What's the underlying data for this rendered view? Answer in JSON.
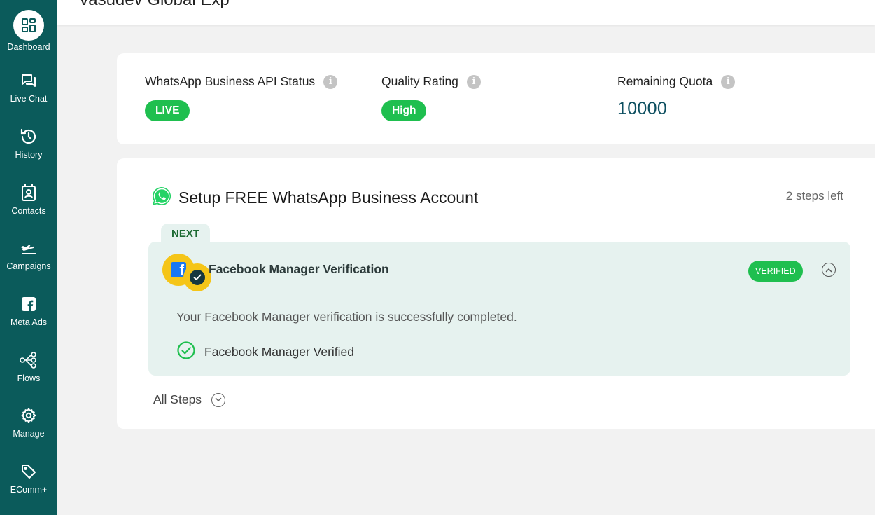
{
  "header": {
    "org_name": "Vasudev Global Exp"
  },
  "sidebar": {
    "items": [
      {
        "label": "Dashboard",
        "icon": "dashboard-icon"
      },
      {
        "label": "Live Chat",
        "icon": "chat-icon"
      },
      {
        "label": "History",
        "icon": "history-icon"
      },
      {
        "label": "Contacts",
        "icon": "contacts-icon"
      },
      {
        "label": "Campaigns",
        "icon": "plane-icon"
      },
      {
        "label": "Meta Ads",
        "icon": "facebook-icon"
      },
      {
        "label": "Flows",
        "icon": "flow-icon"
      },
      {
        "label": "Manage",
        "icon": "gear-icon"
      },
      {
        "label": "EComm+",
        "icon": "tag-icon"
      }
    ]
  },
  "status": {
    "api_status": {
      "title": "WhatsApp Business API Status",
      "value": "LIVE"
    },
    "quality": {
      "title": "Quality Rating",
      "value": "High"
    },
    "quota": {
      "title": "Remaining Quota",
      "value": "10000"
    }
  },
  "setup": {
    "title": "Setup FREE WhatsApp Business Account",
    "steps_left": "2 steps left",
    "next_label": "NEXT",
    "step": {
      "title": "Facebook Manager Verification",
      "badge": "VERIFIED",
      "description": "Your Facebook Manager verification is successfully completed.",
      "check_text": "Facebook Manager Verified"
    },
    "all_steps_label": "All Steps"
  },
  "colors": {
    "sidebar_bg": "#0b5b5b",
    "status_green": "#1fbf4f",
    "step_bg": "#e6f2ef",
    "badge_yellow": "#f5c518"
  }
}
